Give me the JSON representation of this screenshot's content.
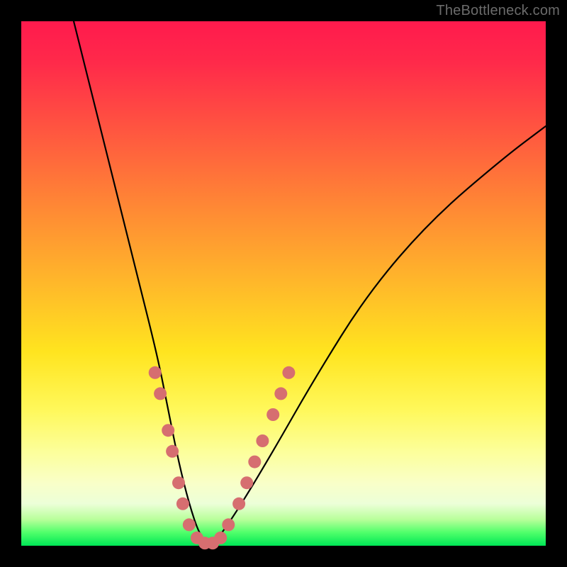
{
  "watermark": "TheBottleneck.com",
  "chart_data": {
    "type": "line",
    "title": "",
    "xlabel": "",
    "ylabel": "",
    "xlim": [
      0,
      100
    ],
    "ylim": [
      0,
      100
    ],
    "series": [
      {
        "name": "bottleneck-curve",
        "x": [
          10,
          14,
          18,
          22,
          26,
          28,
          30,
          32,
          34,
          36,
          38,
          42,
          48,
          56,
          66,
          78,
          92,
          100
        ],
        "values": [
          100,
          84,
          68,
          52,
          36,
          26,
          16,
          8,
          2,
          0,
          2,
          8,
          18,
          32,
          48,
          62,
          74,
          80
        ]
      }
    ],
    "markers": {
      "name": "highlight-dots",
      "color": "#d66e70",
      "points": [
        {
          "x": 25.5,
          "y": 33
        },
        {
          "x": 26.5,
          "y": 29
        },
        {
          "x": 28.0,
          "y": 22
        },
        {
          "x": 28.8,
          "y": 18
        },
        {
          "x": 30.0,
          "y": 12
        },
        {
          "x": 30.8,
          "y": 8
        },
        {
          "x": 32.0,
          "y": 4
        },
        {
          "x": 33.5,
          "y": 1.5
        },
        {
          "x": 35.0,
          "y": 0.5
        },
        {
          "x": 36.5,
          "y": 0.5
        },
        {
          "x": 38.0,
          "y": 1.5
        },
        {
          "x": 39.5,
          "y": 4
        },
        {
          "x": 41.5,
          "y": 8
        },
        {
          "x": 43.0,
          "y": 12
        },
        {
          "x": 44.5,
          "y": 16
        },
        {
          "x": 46.0,
          "y": 20
        },
        {
          "x": 48.0,
          "y": 25
        },
        {
          "x": 49.5,
          "y": 29
        },
        {
          "x": 51.0,
          "y": 33
        }
      ]
    },
    "gradient_stops": [
      {
        "pos": 0,
        "color": "#ff1a4d"
      },
      {
        "pos": 0.5,
        "color": "#ffb82a"
      },
      {
        "pos": 0.82,
        "color": "#fcff9a"
      },
      {
        "pos": 1.0,
        "color": "#00e756"
      }
    ]
  }
}
